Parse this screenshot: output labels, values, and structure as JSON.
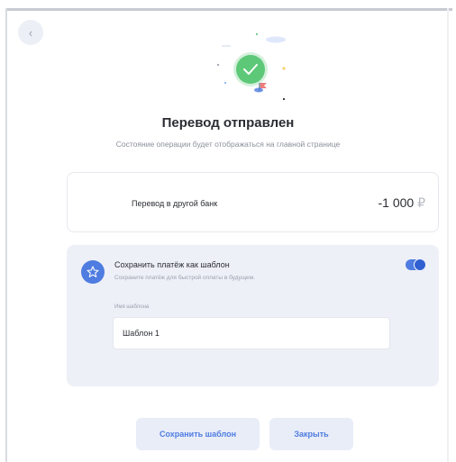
{
  "header": {
    "back_icon": "chevron-left-icon",
    "back_glyph": "‹"
  },
  "status": {
    "icon": "check-success-icon",
    "title": "Перевод отправлен",
    "subtitle": "Состояние операции будет отображаться на главной странице"
  },
  "transfer": {
    "label": "Перевод в другой банк",
    "amount": "-1 000",
    "currency": "₽"
  },
  "template": {
    "icon": "star-icon",
    "title": "Сохранить платёж как шаблон",
    "description": "Сохраните платёж для быстрой оплаты в будущем.",
    "toggle_on": true,
    "field_label": "Имя шаблона",
    "field_value": "Шаблон 1"
  },
  "actions": {
    "save_label": "Сохранить шаблон",
    "close_label": "Закрыть"
  },
  "colors": {
    "accent": "#4e7ce0",
    "success": "#5cc878",
    "card_bg": "#eef0f7"
  }
}
